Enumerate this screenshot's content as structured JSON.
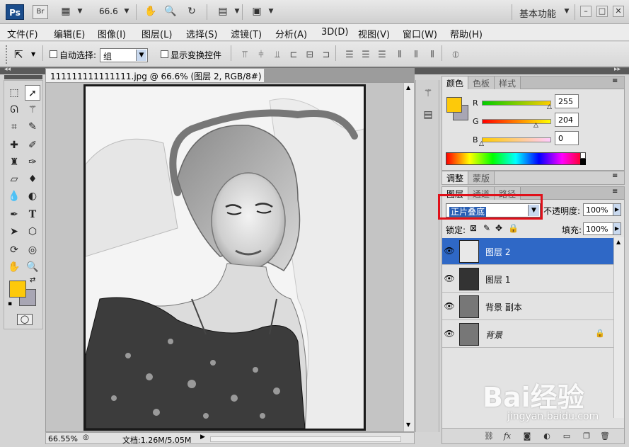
{
  "appbar": {
    "logo": "Ps",
    "bridge": "Br",
    "zoom": "66.6",
    "workspace": "基本功能",
    "icons": [
      "screen-mode-icon",
      "hand-icon",
      "zoom-icon",
      "rotate-view-icon",
      "arrange-docs-icon",
      "screen-mode-2-icon"
    ],
    "win_buttons": [
      "minimize-icon",
      "maximize-icon",
      "close-icon"
    ]
  },
  "menu": [
    "文件(F)",
    "编辑(E)",
    "图像(I)",
    "图层(L)",
    "选择(S)",
    "滤镜(T)",
    "分析(A)",
    "3D(D)",
    "视图(V)",
    "窗口(W)",
    "帮助(H)"
  ],
  "options": {
    "auto_select_label": "自动选择:",
    "auto_select_value": "组",
    "show_transform_label": "显示变换控件",
    "auto_select_checked": false,
    "show_transform_checked": false
  },
  "document": {
    "tab_title": "111111111111111.jpg @ 66.6% (图层 2, RGB/8#) *",
    "close": "×",
    "status_zoom": "66.55%",
    "status_doc": "文档:1.26M/5.05M"
  },
  "color_panel": {
    "tabs": [
      "颜色",
      "色板",
      "样式"
    ],
    "r_label": "R",
    "g_label": "G",
    "b_label": "B",
    "r": "255",
    "g": "204",
    "b": "0",
    "foreground": "#fdc90a",
    "background": "#a8a6b4"
  },
  "adjust_panel": {
    "tabs": [
      "调整",
      "蒙版"
    ]
  },
  "layers_panel": {
    "tabs": [
      "图层",
      "通道",
      "路径"
    ],
    "blend_mode": "正片叠底",
    "opacity_label": "不透明度:",
    "opacity": "100%",
    "lock_label": "锁定:",
    "fill_label": "填充:",
    "fill": "100%",
    "layers": [
      {
        "name": "图层 2",
        "selected": true,
        "locked": false
      },
      {
        "name": "图层 1",
        "selected": false,
        "locked": false
      },
      {
        "name": "背景 副本",
        "selected": false,
        "locked": false
      },
      {
        "name": "背景",
        "selected": false,
        "locked": true
      }
    ]
  },
  "watermark": {
    "brand": "Bai经验",
    "url": "jingyan.baidu.com"
  }
}
